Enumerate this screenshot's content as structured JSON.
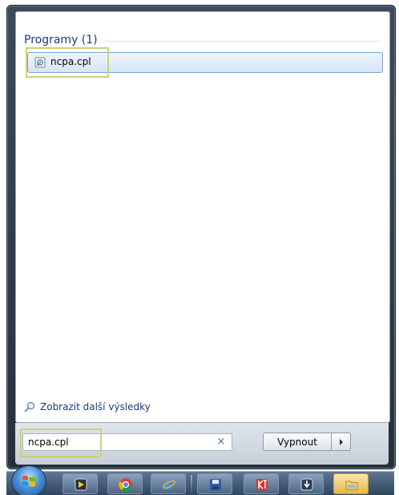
{
  "results": {
    "group_title": "Programy (1)",
    "items": [
      {
        "label": "ncpa.cpl",
        "icon": "control-panel-file-icon"
      }
    ]
  },
  "more_results": {
    "label": "Zobrazit další výsledky",
    "icon": "magnifier-icon"
  },
  "search": {
    "value": "ncpa.cpl",
    "clear_glyph": "×"
  },
  "shutdown": {
    "label": "Vypnout",
    "arrow_icon": "arrow-right-icon"
  },
  "taskbar": {
    "items": [
      {
        "icon": "start-orb-icon"
      },
      {
        "icon": "media-app-icon"
      },
      {
        "icon": "chrome-icon"
      },
      {
        "icon": "internet-explorer-icon"
      },
      {
        "icon": "save-app-icon"
      },
      {
        "icon": "kt-app-icon"
      },
      {
        "icon": "download-app-icon"
      },
      {
        "icon": "folder-icon",
        "active": true
      }
    ]
  },
  "colors": {
    "group_title": "#1e3a78",
    "link_text": "#1e3a78",
    "highlight_box": "#c9d27a",
    "selection_border": "#7da2ce"
  }
}
